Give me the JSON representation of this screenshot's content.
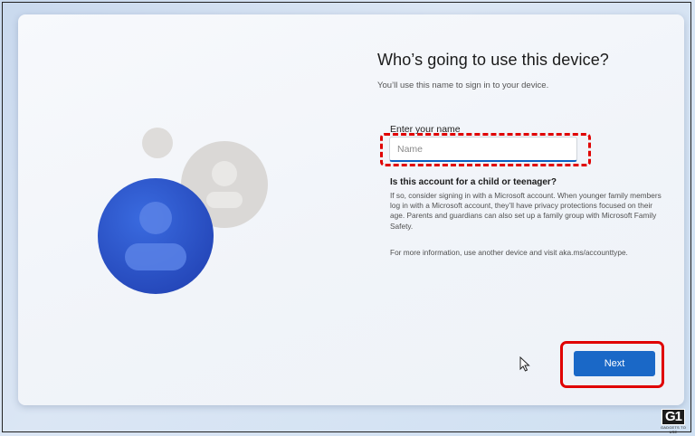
{
  "setup": {
    "title": "Who’s going to use this device?",
    "subtitle": "You’ll use this name to sign in to your device.",
    "name_field": {
      "label": "Enter your name",
      "placeholder": "Name",
      "value": ""
    },
    "child_question": "Is this account for a child or teenager?",
    "child_info": "If so, consider signing in with a Microsoft account. When younger family members log in with a Microsoft account, they’ll have privacy protections focused on their age. Parents and guardians can also set up a family group with Microsoft Family Safety.",
    "more_info": "For more information, use another device and visit aka.ms/accounttype.",
    "next_label": "Next"
  },
  "illustration": {
    "icon": "users-icon",
    "primary_color": "#2d4fc6",
    "secondary_color": "#d8d6d4"
  },
  "watermark": {
    "logo_text": "G1",
    "tagline": "GADGETS TO USE"
  },
  "colors": {
    "accent": "#1a68c7",
    "highlight": "#e00000"
  }
}
